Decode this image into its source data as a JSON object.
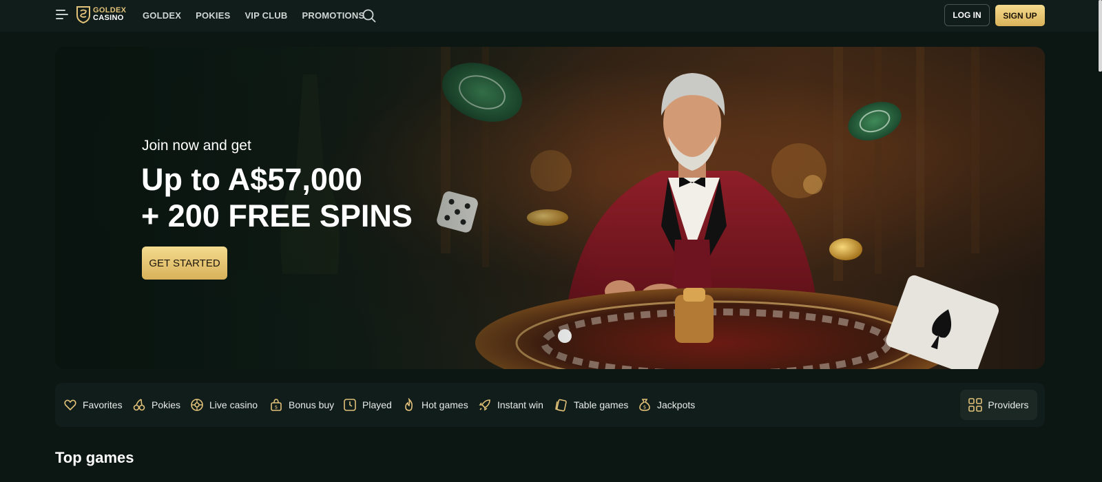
{
  "header": {
    "menu_icon": "hamburger-menu-icon",
    "logo": {
      "line1": "GOLDEX",
      "line2": "CASINO"
    },
    "nav": [
      "GOLDEX",
      "POKIES",
      "VIP CLUB",
      "PROMOTIONS"
    ],
    "search_icon": "search-icon",
    "login_label": "LOG IN",
    "signup_label": "SIGN UP"
  },
  "hero": {
    "subtitle": "Join now and get",
    "title_line1": "Up to A$57,000",
    "title_line2": "+ 200 FREE SPINS",
    "cta_label": "GET STARTED"
  },
  "categories": [
    {
      "label": "Favorites",
      "icon": "heart-icon"
    },
    {
      "label": "Pokies",
      "icon": "cherries-icon"
    },
    {
      "label": "Live casino",
      "icon": "roulette-icon"
    },
    {
      "label": "Bonus buy",
      "icon": "gift-bag-icon"
    },
    {
      "label": "Played",
      "icon": "clock-icon"
    },
    {
      "label": "Hot games",
      "icon": "flame-icon"
    },
    {
      "label": "Instant win",
      "icon": "rocket-icon"
    },
    {
      "label": "Table games",
      "icon": "cards-icon"
    },
    {
      "label": "Jackpots",
      "icon": "money-bag-icon"
    }
  ],
  "providers_label": "Providers",
  "section_title": "Top games",
  "colors": {
    "background": "#0c1714",
    "panel": "#111d1a",
    "gold": "#e3c27a",
    "gold_button": "#f0d285"
  }
}
